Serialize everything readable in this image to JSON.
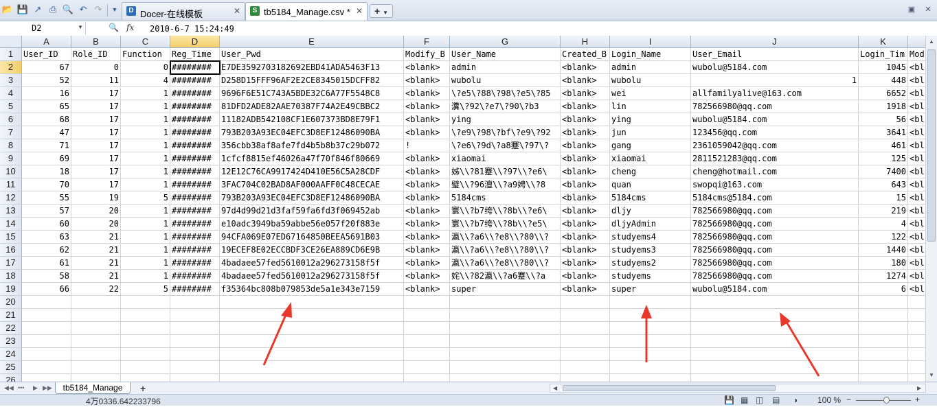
{
  "app": {
    "tabs": [
      {
        "label": "Docer-在线模板",
        "icon": "docer-icon",
        "active": false
      },
      {
        "label": "tb5184_Manage.csv *",
        "icon": "spreadsheet-icon",
        "active": true
      }
    ]
  },
  "formula_bar": {
    "cell_ref": "D2",
    "fx_label": "fx",
    "value": "2010-6-7 15:24:49"
  },
  "columns": [
    "A",
    "B",
    "C",
    "D",
    "E",
    "F",
    "G",
    "H",
    "I",
    "J",
    "K"
  ],
  "selected_column": "D",
  "rows": [
    {
      "n": "1",
      "cells": [
        "User_ID",
        "Role_ID",
        "Function",
        "Reg_Time",
        "User_Pwd",
        "Modify_B",
        "User_Name",
        "Created_B",
        "Login_Name",
        "User_Email",
        "Login_Tim",
        "Mod"
      ]
    },
    {
      "n": "2",
      "cells": [
        "67",
        "0",
        "0",
        "########",
        "E7DE3592703182692EBD41ADA5463F13",
        "<blank>",
        "admin",
        "<blank>",
        "admin",
        "wubolu@5184.com",
        "1045",
        "<bl"
      ]
    },
    {
      "n": "3",
      "cells": [
        "52",
        "11",
        "4",
        "########",
        "D258D15FFF96AF2E2CE8345015DCFF82",
        "<blank>",
        "wubolu",
        "<blank>",
        "wubolu",
        "1",
        "448",
        "<bl"
      ]
    },
    {
      "n": "4",
      "cells": [
        "16",
        "17",
        "1",
        "########",
        "9696F6E51C743A5BDE32C6A77F5548C8",
        "<blank>",
        "\\?e5\\?88\\?98\\?e5\\?85",
        "<blank>",
        "wei",
        "allfamilyalive@163.com",
        "6652",
        "<bl"
      ]
    },
    {
      "n": "5",
      "cells": [
        "65",
        "17",
        "1",
        "########",
        "81DFD2ADE82AAE70387F74A2E49CBBC2",
        "<blank>",
        "瀵\\?92\\?e7\\?90\\?b3",
        "<blank>",
        "lin",
        "782566980@qq.com",
        "1918",
        "<bl"
      ]
    },
    {
      "n": "6",
      "cells": [
        "68",
        "17",
        "1",
        "########",
        "11182ADB542108CF1E607373BD8E79F1",
        "<blank>",
        "ying",
        "<blank>",
        "ying",
        "wubolu@5184.com",
        "56",
        "<bl"
      ]
    },
    {
      "n": "7",
      "cells": [
        "47",
        "17",
        "1",
        "########",
        "793B203A93EC04EFC3D8EF12486090BA",
        "<blank>",
        "\\?e9\\?98\\?bf\\?e9\\?92",
        "<blank>",
        "jun",
        "123456@qq.com",
        "3641",
        "<bl"
      ]
    },
    {
      "n": "8",
      "cells": [
        "71",
        "17",
        "1",
        "########",
        "356cbb38af8afe7fd4b5b8b37c29b072",
        "!",
        "\\?e6\\?9d\\?a8蹇\\?97\\?",
        "<blank>",
        "gang",
        "2361059042@qq.com",
        "461",
        "<bl"
      ]
    },
    {
      "n": "9",
      "cells": [
        "69",
        "17",
        "1",
        "########",
        "1cfcf8815ef46026a47f70f846f80669",
        "<blank>",
        "xiaomai",
        "<blank>",
        "xiaomai",
        "2811521283@qq.com",
        "125",
        "<bl"
      ]
    },
    {
      "n": "10",
      "cells": [
        "18",
        "17",
        "1",
        "########",
        "12E12C76CA9917424D410E56C5A28CDF",
        "<blank>",
        "姊\\\\?81蹇\\\\?97\\\\?e6\\",
        "<blank>",
        "cheng",
        "cheng@hotmail.com",
        "7400",
        "<bl"
      ]
    },
    {
      "n": "11",
      "cells": [
        "70",
        "17",
        "1",
        "########",
        "3FAC704C02BAD8AF000AAFF0C48CECAE",
        "<blank>",
        "璧\\\\?96澶\\\\?a9娉\\\\?8",
        "<blank>",
        "quan",
        "swopqi@163.com",
        "643",
        "<bl"
      ]
    },
    {
      "n": "12",
      "cells": [
        "55",
        "19",
        "5",
        "########",
        "793B203A93EC04EFC3D8EF12486090BA",
        "<blank>",
        "5184cms",
        "<blank>",
        "5184cms",
        "5184cms@5184.com",
        "15",
        "<bl"
      ]
    },
    {
      "n": "13",
      "cells": [
        "57",
        "20",
        "1",
        "########",
        "97d4d99d21d3faf59fa6fd3f069452ab",
        "<blank>",
        "寰\\\\?b7绔\\\\?8b\\\\?e6\\",
        "<blank>",
        "dljy",
        "782566980@qq.com",
        "219",
        "<bl"
      ]
    },
    {
      "n": "14",
      "cells": [
        "60",
        "20",
        "1",
        "########",
        "e10adc3949ba59abbe56e057f20f883e",
        "<blank>",
        "寰\\\\?b7绔\\\\?8b\\\\?e5\\",
        "<blank>",
        "dljyAdmin",
        "782566980@qq.com",
        "4",
        "<bl"
      ]
    },
    {
      "n": "15",
      "cells": [
        "63",
        "21",
        "1",
        "########",
        "94CFA069E07ED67164850BEEA5691B03",
        "<blank>",
        "瀛\\\\?a6\\\\?e8\\\\?80\\\\?",
        "<blank>",
        "studyems4",
        "782566980@qq.com",
        "122",
        "<bl"
      ]
    },
    {
      "n": "16",
      "cells": [
        "62",
        "21",
        "1",
        "########",
        "19ECEF8E02ECCBDF3CE26EA889CD6E9B",
        "<blank>",
        "瀛\\\\?a6\\\\?e8\\\\?80\\\\?",
        "<blank>",
        "studyems3",
        "782566980@qq.com",
        "1440",
        "<bl"
      ]
    },
    {
      "n": "17",
      "cells": [
        "61",
        "21",
        "1",
        "########",
        "4badaee57fed5610012a296273158f5f",
        "<blank>",
        "瀛\\\\?a6\\\\?e8\\\\?80\\\\?",
        "<blank>",
        "studyems2",
        "782566980@qq.com",
        "180",
        "<bl"
      ]
    },
    {
      "n": "18",
      "cells": [
        "58",
        "21",
        "1",
        "########",
        "4badaee57fed5610012a296273158f5f",
        "<blank>",
        "姹\\\\?82瀛\\\\?a6蹇\\\\?a",
        "<blank>",
        "studyems",
        "782566980@qq.com",
        "1274",
        "<bl"
      ]
    },
    {
      "n": "19",
      "cells": [
        "66",
        "22",
        "5",
        "########",
        "f35364bc808b079853de5a1e343e7159",
        "<blank>",
        "super",
        "<blank>",
        "super",
        "wubolu@5184.com",
        "6",
        "<bl"
      ]
    },
    {
      "n": "20",
      "cells": []
    },
    {
      "n": "21",
      "cells": []
    },
    {
      "n": "22",
      "cells": []
    },
    {
      "n": "23",
      "cells": []
    },
    {
      "n": "24",
      "cells": []
    },
    {
      "n": "25",
      "cells": []
    },
    {
      "n": "26",
      "cells": []
    }
  ],
  "sheet": {
    "tab_label": "tb5184_Manage"
  },
  "status": {
    "text": "4万0336.642233796",
    "zoom": "100 %",
    "zoom_fraction": 0.55
  },
  "colors": {
    "selection": "#f3cf6a",
    "arrow": "#e8382c",
    "header": "#dbe3ef"
  }
}
